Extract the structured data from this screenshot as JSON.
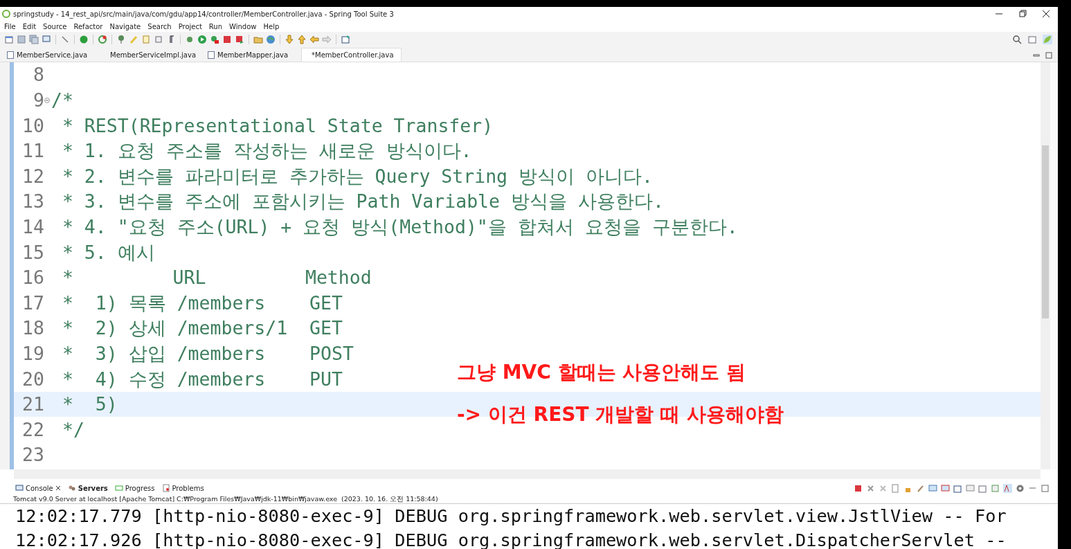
{
  "window": {
    "title": "springstudy - 14_rest_api/src/main/java/com/gdu/app14/controller/MemberController.java - Spring Tool Suite 3"
  },
  "menu": [
    "File",
    "Edit",
    "Source",
    "Refactor",
    "Navigate",
    "Search",
    "Project",
    "Run",
    "Window",
    "Help"
  ],
  "editor_tabs": [
    {
      "label": "MemberService.java",
      "selected": false
    },
    {
      "label": "MemberServiceImpl.java",
      "selected": false
    },
    {
      "label": "MemberMapper.java",
      "selected": false
    },
    {
      "label": "*MemberController.java",
      "selected": true
    }
  ],
  "code_lines": [
    {
      "number": "8",
      "current": false,
      "fold": false
    },
    {
      "number": "9",
      "text": "/*",
      "current": false,
      "fold": true
    },
    {
      "number": "10",
      "text": " * REST(REpresentational State Transfer)",
      "current": false,
      "fold": false
    },
    {
      "number": "11",
      "text": " * 1. 요청 주소를 작성하는 새로운 방식이다.",
      "current": false,
      "fold": false
    },
    {
      "number": "12",
      "text": " * 2. 변수를 파라미터로 추가하는 Query String 방식이 아니다.",
      "current": false,
      "fold": false
    },
    {
      "number": "13",
      "text": " * 3. 변수를 주소에 포함시키는 Path Variable 방식을 사용한다.",
      "current": false,
      "fold": false
    },
    {
      "number": "14",
      "text": " * 4. \"요청 주소(URL) + 요청 방식(Method)\"을 합쳐서 요청을 구분한다.",
      "current": false,
      "fold": false
    },
    {
      "number": "15",
      "text": " * 5. 예시",
      "current": false,
      "fold": false
    },
    {
      "number": "16",
      "text": " *         URL         Method",
      "current": false,
      "fold": false
    },
    {
      "number": "17",
      "text": " *  1) 목록 /members    GET",
      "current": false,
      "fold": false
    },
    {
      "number": "18",
      "text": " *  2) 상세 /members/1  GET",
      "current": false,
      "fold": false
    },
    {
      "number": "19",
      "text": " *  3) 삽입 /members    POST",
      "current": false,
      "fold": false
    },
    {
      "number": "20",
      "text": " *  4) 수정 /members    PUT",
      "current": false,
      "fold": false
    },
    {
      "number": "21",
      "text": " *  5)",
      "current": true,
      "fold": false
    },
    {
      "number": "22",
      "text": " */",
      "current": false,
      "fold": false
    },
    {
      "number": "23",
      "current": false,
      "fold": false
    }
  ],
  "annotation": [
    "그냥 MVC 할때는 사용안해도 됨",
    "-> 이건 REST 개발할 때 사용해야함"
  ],
  "console_tabs": [
    {
      "label": "Console",
      "selected": false
    },
    {
      "label": "Servers",
      "selected": true
    },
    {
      "label": "Progress",
      "selected": false
    },
    {
      "label": "Problems",
      "selected": false
    }
  ],
  "console": {
    "description": "Tomcat v9.0 Server at localhost [Apache Tomcat] C:₩Program Files₩Java₩jdk-11₩bin₩javaw.exe  (2023. 10. 16. 오전 11:58:44)",
    "lines": [
      "12:02:17.779 [http-nio-8080-exec-9] DEBUG org.springframework.web.servlet.view.JstlView -- For",
      "12:02:17.926 [http-nio-8080-exec-9] DEBUG org.springframework.web.servlet.DispatcherServlet --"
    ]
  }
}
